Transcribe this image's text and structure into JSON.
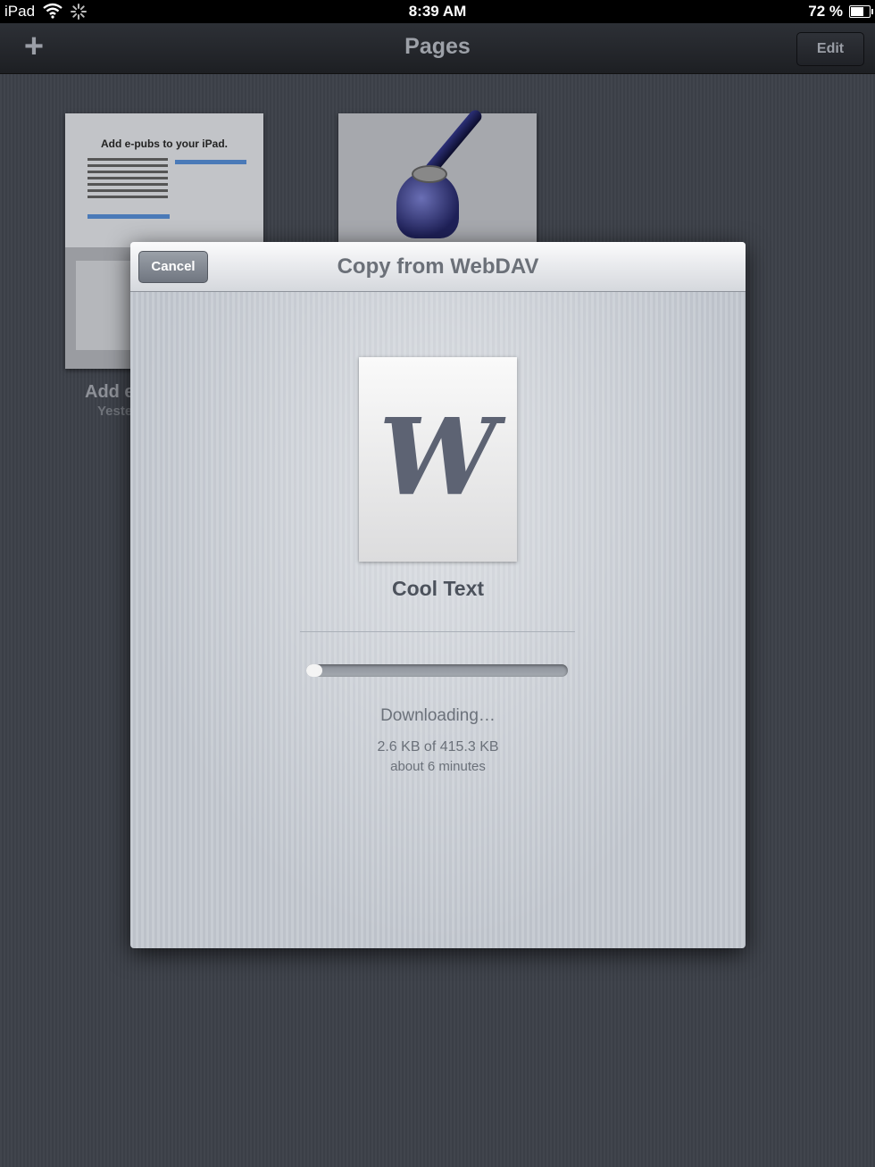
{
  "status_bar": {
    "carrier": "iPad",
    "time": "8:39 AM",
    "battery_percent": "72 %",
    "battery_level": 0.72,
    "icons": [
      "wifi-icon",
      "activity-spinner-icon",
      "battery-icon"
    ]
  },
  "nav_bar": {
    "add_label": "+",
    "title": "Pages",
    "edit_label": "Edit"
  },
  "documents": [
    {
      "thumb_heading": "Add e-pubs to your iPad.",
      "label": "Add e",
      "date": "Yeste"
    }
  ],
  "modal": {
    "title": "Copy from WebDAV",
    "cancel_label": "Cancel",
    "file_icon_glyph": "W",
    "file_name": "Cool Text",
    "progress": 0.006,
    "status": "Downloading…",
    "size": "2.6 KB of 415.3 KB",
    "eta": "about 6 minutes"
  },
  "colors": {
    "modal_bg": "#c7ccd3",
    "text": "#6b717a",
    "nav_bg": "#2d3036"
  }
}
